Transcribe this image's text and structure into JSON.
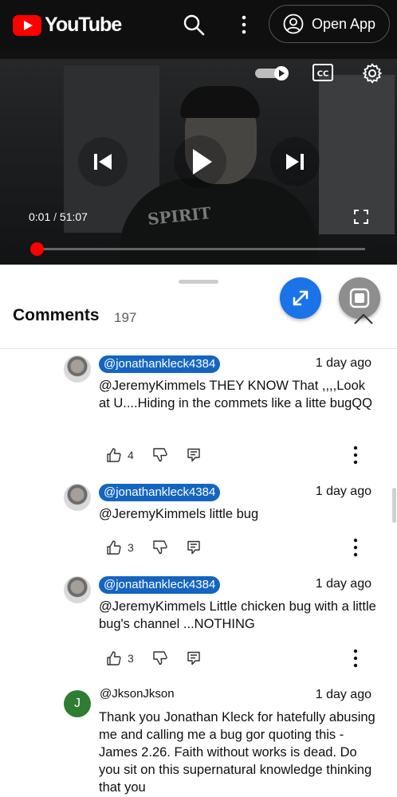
{
  "header": {
    "brand": "YouTube",
    "open_app_label": "Open App",
    "icons": [
      "search-icon",
      "more-vert-icon",
      "account-circle-icon"
    ]
  },
  "player": {
    "current_time": "0:01",
    "separator": "/",
    "duration": "51:07",
    "shirt_text": "SPIRIT",
    "progress_fraction": 0.001,
    "icons": [
      "autoplay-toggle-icon",
      "closed-captions-icon",
      "settings-gear-icon",
      "previous-icon",
      "play-icon",
      "next-icon",
      "fullscreen-icon"
    ],
    "accent_color": "#ff0000"
  },
  "comments": {
    "title": "Comments",
    "count": "197",
    "items": [
      {
        "author": "@jonathankleck4384",
        "highlighted": true,
        "date": "1 day ago",
        "text": "@JeremyKimmels THEY KNOW That ,,,,Look at U....Hiding in the commets like a litte bugQQ",
        "likes": "4"
      },
      {
        "author": "@jonathankleck4384",
        "highlighted": true,
        "date": "1 day ago",
        "text": "@JeremyKimmels little bug",
        "likes": "3"
      },
      {
        "author": "@jonathankleck4384",
        "highlighted": true,
        "date": "1 day ago",
        "text": "@JeremyKimmels Little chicken bug with a little bug's channel ...NOTHING",
        "likes": "3"
      },
      {
        "author": "@JksonJkson",
        "avatar_letter": "J",
        "highlighted": false,
        "date": "1 day ago",
        "text": "Thank you Jonathan Kleck for hatefully abusing me and calling me a bug gor quoting this - James 2.26. Faith without works is dead. Do you sit on this supernatural knowledge thinking that you",
        "likes": ""
      }
    ],
    "highlight_color": "#1565c0",
    "fab_color": "#1a73e8"
  }
}
